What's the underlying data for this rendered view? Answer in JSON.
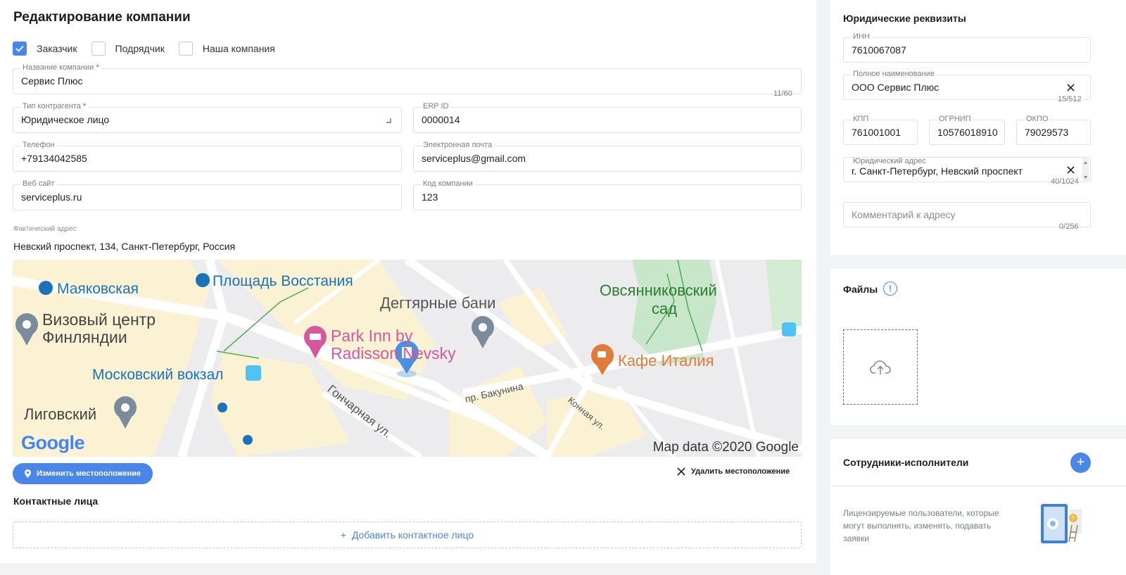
{
  "page_title": "Редактирование компании",
  "roles": [
    {
      "label": "Заказчик",
      "checked": true
    },
    {
      "label": "Подрядчик",
      "checked": false
    },
    {
      "label": "Наша компания",
      "checked": false
    }
  ],
  "form": {
    "company_name": {
      "label": "Название компании",
      "required": "*",
      "value": "Сервис Плюс",
      "counter": "11/60"
    },
    "contractor_type": {
      "label": "Тип контрагента",
      "required": "*",
      "value": "Юридическое лицо"
    },
    "erp_id": {
      "label": "ERP ID",
      "value": "0000014"
    },
    "phone": {
      "label": "Телефон",
      "value": "+79134042585"
    },
    "email": {
      "label": "Электронная почта",
      "value": "serviceplus@gmail.com"
    },
    "website": {
      "label": "Веб сайт",
      "value": "serviceplus.ru"
    },
    "company_code": {
      "label": "Код компании",
      "value": "123"
    }
  },
  "actual_address": {
    "caption": "Фактический адрес",
    "value": "Невский проспект, 134, Санкт-Петербург, Россия"
  },
  "map": {
    "labels": {
      "mayak": "Маяковская",
      "vosstaniya": "Площадь Восстания",
      "degtyarnye": "Дегтярные бани",
      "ovsyann1": "Овсянниковский",
      "ovsyann2": "сад",
      "vizovy1": "Визовый центр",
      "vizovy2": "Финляндии",
      "parkinn1": "Park Inn by",
      "parkinn2": "Radisson Nevsky",
      "kafe": "Кафе Италия",
      "moskovsky": "Московский вокзал",
      "ligovsky": "Лиговский",
      "bakunina": "пр. Бакунина",
      "goncharnaya": "Гончарная ул.",
      "konnaya": "Конная ул."
    },
    "google": "Google",
    "copyright": "Map data ©2020 Google"
  },
  "actions": {
    "change_location": "Изменить местоположение",
    "delete_location": "Удалить местоположение"
  },
  "contacts": {
    "title": "Контактные лица",
    "add": "Добавить контактное лицо"
  },
  "legal": {
    "title": "Юридические реквизиты",
    "inn": {
      "label": "ИНН",
      "value": "7610067087"
    },
    "full_name": {
      "label": "Полное наименование",
      "value": "ООО Сервис Плюс",
      "counter": "15/512"
    },
    "kpp": {
      "label": "КПП",
      "value": "761001001"
    },
    "ogrnip": {
      "label": "ОГРНИП",
      "value": "10576018910"
    },
    "okpo": {
      "label": "ОКПО",
      "value": "79029573"
    },
    "legal_address": {
      "label": "Юридический адрес",
      "value": "г. Санкт-Петербург, Невский проспект",
      "counter": "40/1024"
    },
    "address_comment": {
      "placeholder": "Комментарий к адресу",
      "counter": "0/256"
    }
  },
  "files": {
    "title": "Файлы",
    "info_glyph": "!"
  },
  "staff": {
    "title": "Сотрудники-исполнители",
    "description": "Лицензируемые пользователи, которые могут выполнять, изменять, подавать заявки"
  },
  "colors": {
    "accent": "#4a86e8",
    "required": "#e53935",
    "map_park": "#2e7d32",
    "map_transit": "#1a73b8",
    "map_hotel": "#d6589c",
    "map_cafe": "#e07b39"
  }
}
